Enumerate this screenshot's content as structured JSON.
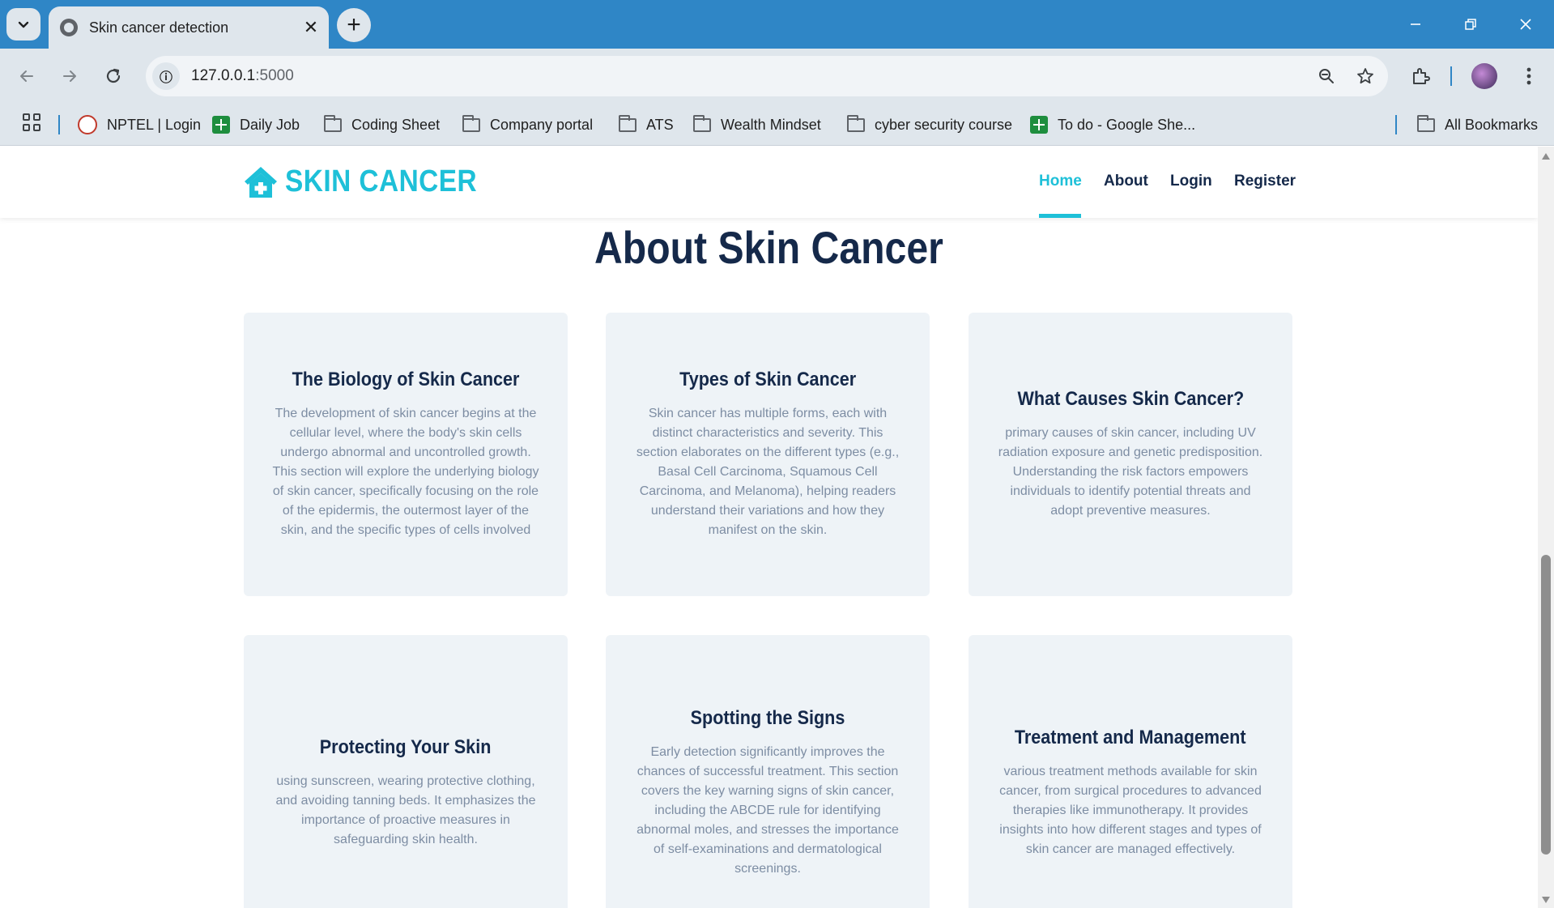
{
  "browser": {
    "tab_title": "Skin cancer detection",
    "new_tab_label": "+",
    "url_host": "127.0.0.1",
    "url_port": ":5000",
    "bookmarks": [
      {
        "label": "NPTEL | Login",
        "icon": "nptel-icon"
      },
      {
        "label": "Daily Job",
        "icon": "sheets-icon"
      },
      {
        "label": "Coding Sheet",
        "icon": "folder-icon"
      },
      {
        "label": "Company portal",
        "icon": "folder-icon"
      },
      {
        "label": "ATS",
        "icon": "folder-icon"
      },
      {
        "label": "Wealth Mindset",
        "icon": "folder-icon"
      },
      {
        "label": "cyber security course",
        "icon": "folder-icon"
      },
      {
        "label": "To do - Google She...",
        "icon": "sheets-icon"
      }
    ],
    "all_bookmarks": "All Bookmarks"
  },
  "site": {
    "logo_text": "SKIN CANCER",
    "nav": [
      {
        "label": "Home",
        "active": true
      },
      {
        "label": "About",
        "active": false
      },
      {
        "label": "Login",
        "active": false
      },
      {
        "label": "Register",
        "active": false
      }
    ],
    "accent_color": "#1ec0d8",
    "heading_color": "#15294a"
  },
  "about": {
    "title": "About Skin Cancer",
    "cards": [
      {
        "title": "The Biology of Skin Cancer",
        "text": "The development of skin cancer begins at the cellular level, where the body's skin cells undergo abnormal and uncontrolled growth. This section will explore the underlying biology of skin cancer, specifically focusing on the role of the epidermis, the outermost layer of the skin, and the specific types of cells involved"
      },
      {
        "title": "Types of Skin Cancer",
        "text": "Skin cancer has multiple forms, each with distinct characteristics and severity. This section elaborates on the different types (e.g., Basal Cell Carcinoma, Squamous Cell Carcinoma, and Melanoma), helping readers understand their variations and how they manifest on the skin."
      },
      {
        "title": "What Causes Skin Cancer?",
        "text": "primary causes of skin cancer, including UV radiation exposure and genetic predisposition. Understanding the risk factors empowers individuals to identify potential threats and adopt preventive measures."
      },
      {
        "title": "Protecting Your Skin",
        "text": "using sunscreen, wearing protective clothing, and avoiding tanning beds. It emphasizes the importance of proactive measures in safeguarding skin health."
      },
      {
        "title": "Spotting the Signs",
        "text": "Early detection significantly improves the chances of successful treatment. This section covers the key warning signs of skin cancer, including the ABCDE rule for identifying abnormal moles, and stresses the importance of self-examinations and dermatological screenings."
      },
      {
        "title": "Treatment and Management",
        "text": "various treatment methods available for skin cancer, from surgical procedures to advanced therapies like immunotherapy. It provides insights into how different stages and types of skin cancer are managed effectively."
      }
    ]
  }
}
